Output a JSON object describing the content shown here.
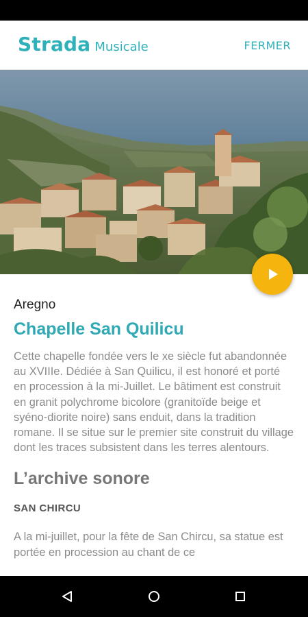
{
  "app": {
    "brand_name": "Strada",
    "brand_sub": "Musicale",
    "close_label": "FERMER"
  },
  "hero": {
    "image": "coastal-village-photo",
    "play_icon": "play-icon",
    "accent_color": "#f6b40e"
  },
  "place": {
    "village": "Aregno",
    "title": "Chapelle San Quilicu",
    "description": "Cette chapelle fondée vers le xe siècle fut abandonnée au XVIIIe. Dédiée à San Quilicu, il est honoré et porté en procession à la mi-Juillet. Le bâtiment est construit en granit polychrome bicolore (granitoïde beige et syéno-diorite noire) sans enduit, dans la tradition romane. Il se situe sur le premier site construit du village dont les traces subsistent dans les terres alentours."
  },
  "archive": {
    "heading": "L’archive sonore",
    "track_title": "SAN CHIRCU",
    "track_text": "A la mi-juillet, pour la fête de San Chircu, sa statue est portée en procession au chant de ce"
  },
  "nav": {
    "back_icon": "back-triangle-icon",
    "home_icon": "home-circle-icon",
    "recents_icon": "recents-square-icon"
  },
  "colors": {
    "brand": "#2fb1b9",
    "title": "#2fa9b3",
    "body_text": "#8a8a8a"
  }
}
